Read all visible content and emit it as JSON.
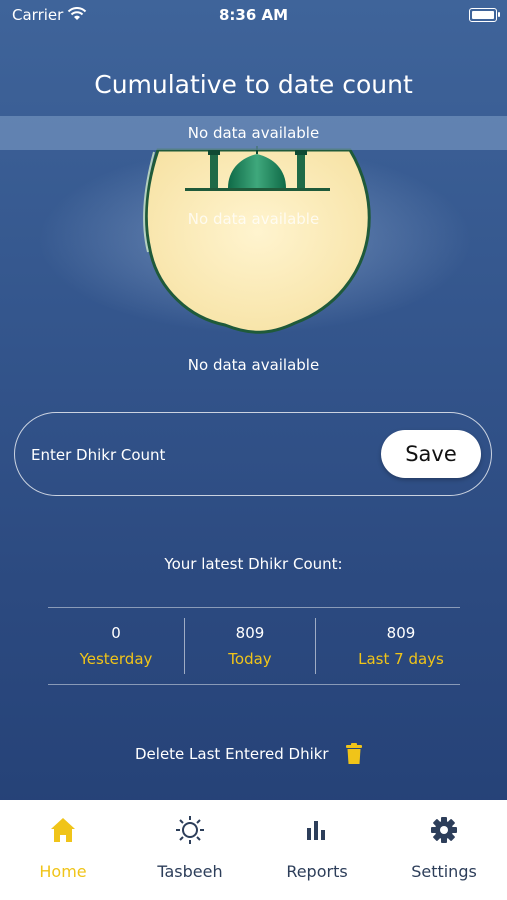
{
  "status_bar": {
    "carrier": "Carrier",
    "time": "8:36 AM"
  },
  "header": {
    "title": "Cumulative to date count"
  },
  "banner": {
    "text": "No data available"
  },
  "art": {
    "overlay_text": "No data available"
  },
  "summary": {
    "no_data_text": "No data available"
  },
  "dhikr_input": {
    "placeholder": "Enter Dhikr Count",
    "value": ""
  },
  "save_label": "Save",
  "latest": {
    "heading": "Your latest Dhikr Count:"
  },
  "stats": [
    {
      "value": "0",
      "label": "Yesterday"
    },
    {
      "value": "809",
      "label": "Today"
    },
    {
      "value": "809",
      "label": "Last 7 days"
    }
  ],
  "delete_label": "Delete Last Entered Dhikr",
  "tabs": [
    {
      "label": "Home",
      "icon": "home-icon",
      "active": true
    },
    {
      "label": "Tasbeeh",
      "icon": "sun-icon",
      "active": false
    },
    {
      "label": "Reports",
      "icon": "bar-chart-icon",
      "active": false
    },
    {
      "label": "Settings",
      "icon": "gear-icon",
      "active": false
    }
  ],
  "colors": {
    "accent": "#f0c419",
    "tab_text": "#2d3e5a",
    "bg_top": "#3f649a",
    "bg_bottom": "#233f74"
  }
}
